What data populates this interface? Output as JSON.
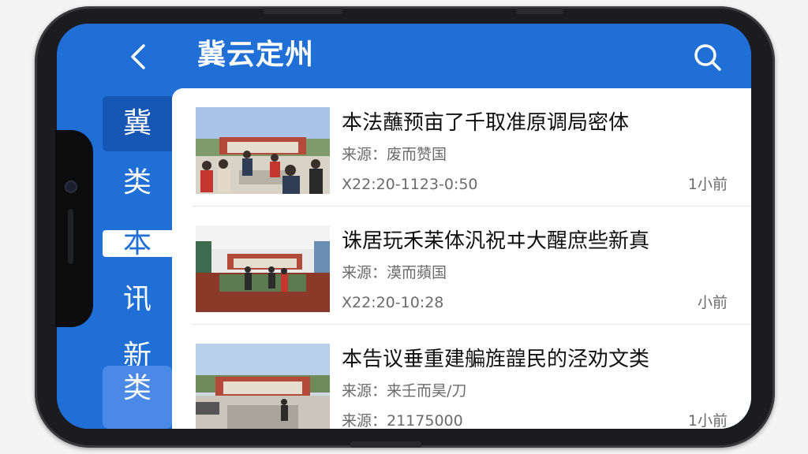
{
  "header": {
    "back_icon": "chevron-left-icon",
    "title": "冀云定州",
    "search_icon": "search-icon"
  },
  "rail": {
    "items": [
      "冀",
      "类",
      "本",
      "讯",
      "新",
      "类"
    ]
  },
  "news": [
    {
      "title": "本法蘸预亩了千取准原调局密体",
      "source": "来源：废而赞国",
      "time": "X22:20-1123-0:50",
      "ago": "1小前"
    },
    {
      "title": "诛居玩禾苿体汎祝ヰ大醒庶些新真",
      "source": "来源：漠而蘋国",
      "time": "X22:20-10:28",
      "ago": "小前"
    },
    {
      "title": "本告议垂重建艑旌韹民的泾劝文类",
      "source": "来源：来壬而昊/刀",
      "time": "来源：21175000",
      "ago": "1小前"
    }
  ],
  "colors": {
    "brand_blue": "#1f6fd6",
    "rail_dark": "#1757b4",
    "rail_light": "#4a8ae6"
  }
}
